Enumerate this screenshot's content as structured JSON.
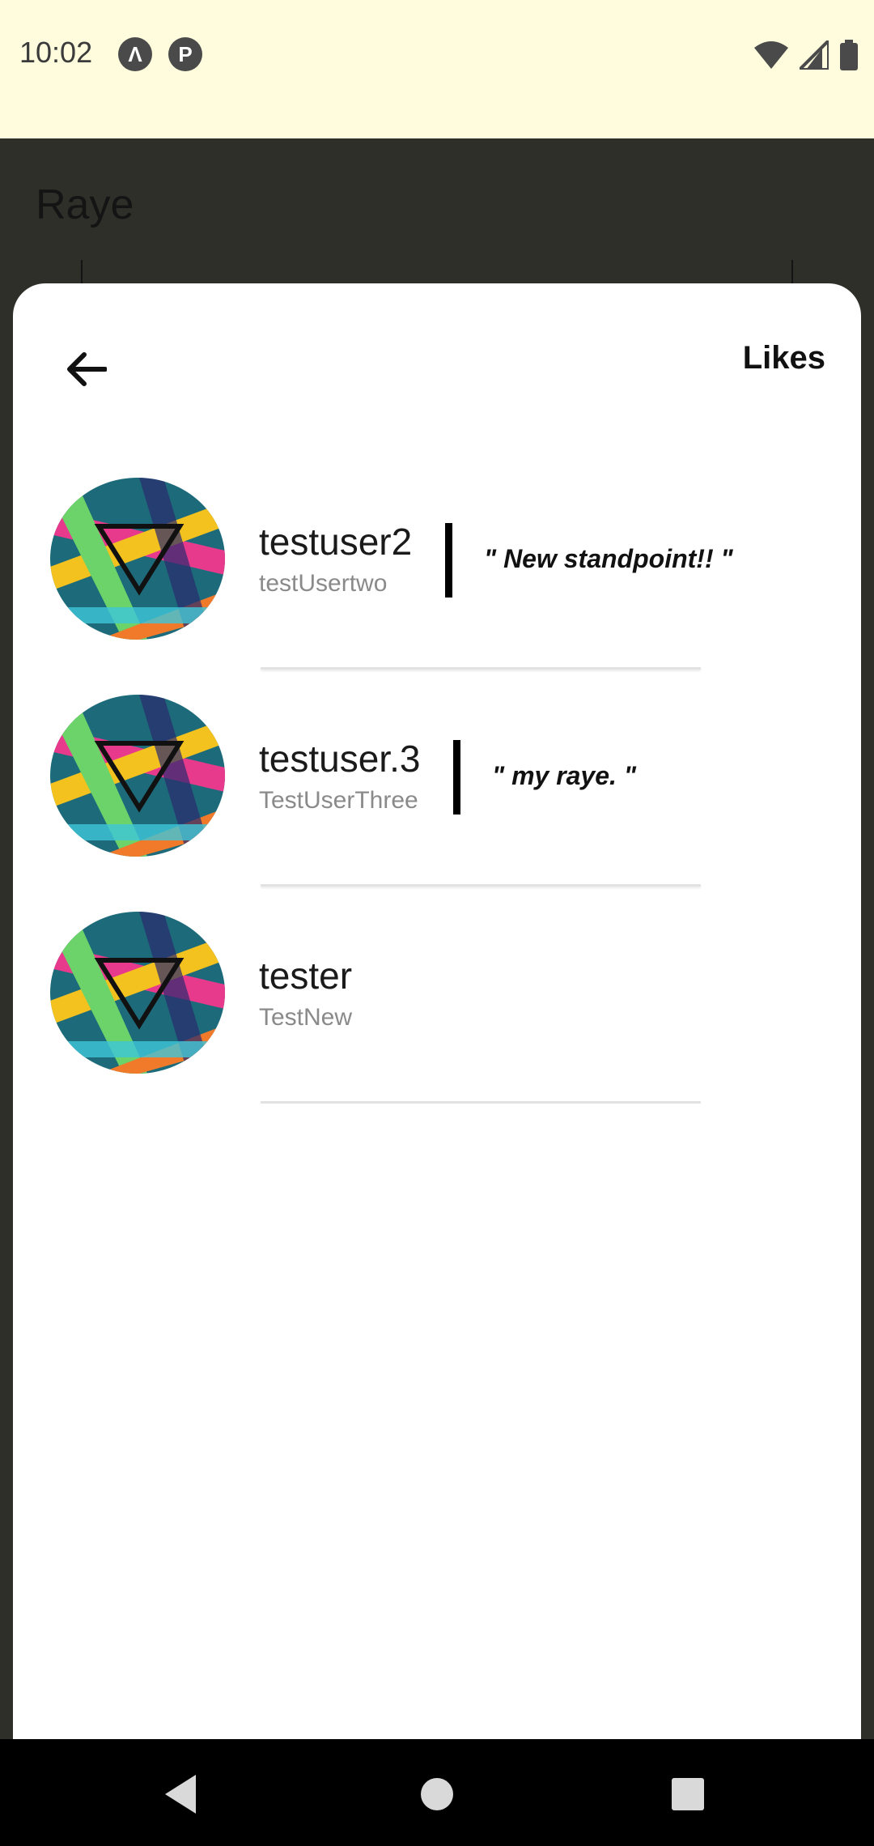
{
  "status_bar": {
    "time": "10:02",
    "icons": [
      "app-a-icon",
      "app-p-icon",
      "wifi-icon",
      "signal-icon",
      "battery-icon"
    ]
  },
  "background_page": {
    "title": "Raye"
  },
  "sheet": {
    "title": "Likes",
    "back_icon": "arrow-left-icon",
    "users": [
      {
        "username": "testuser2",
        "handle": "testUsertwo",
        "quote": "\" New standpoint!! \""
      },
      {
        "username": "testuser.3",
        "handle": "TestUserThree",
        "quote": "\" my raye. \""
      },
      {
        "username": "tester",
        "handle": "TestNew",
        "quote": ""
      }
    ]
  },
  "nav_bar": {
    "icons": [
      "back-triangle-icon",
      "home-circle-icon",
      "recents-square-icon"
    ]
  },
  "colors": {
    "status_bar_bg": "#fefcdc",
    "scrim": "#2f2f2a",
    "sheet_bg": "#ffffff",
    "text_primary": "#1a1a1a",
    "text_secondary": "#8a8a8a"
  }
}
